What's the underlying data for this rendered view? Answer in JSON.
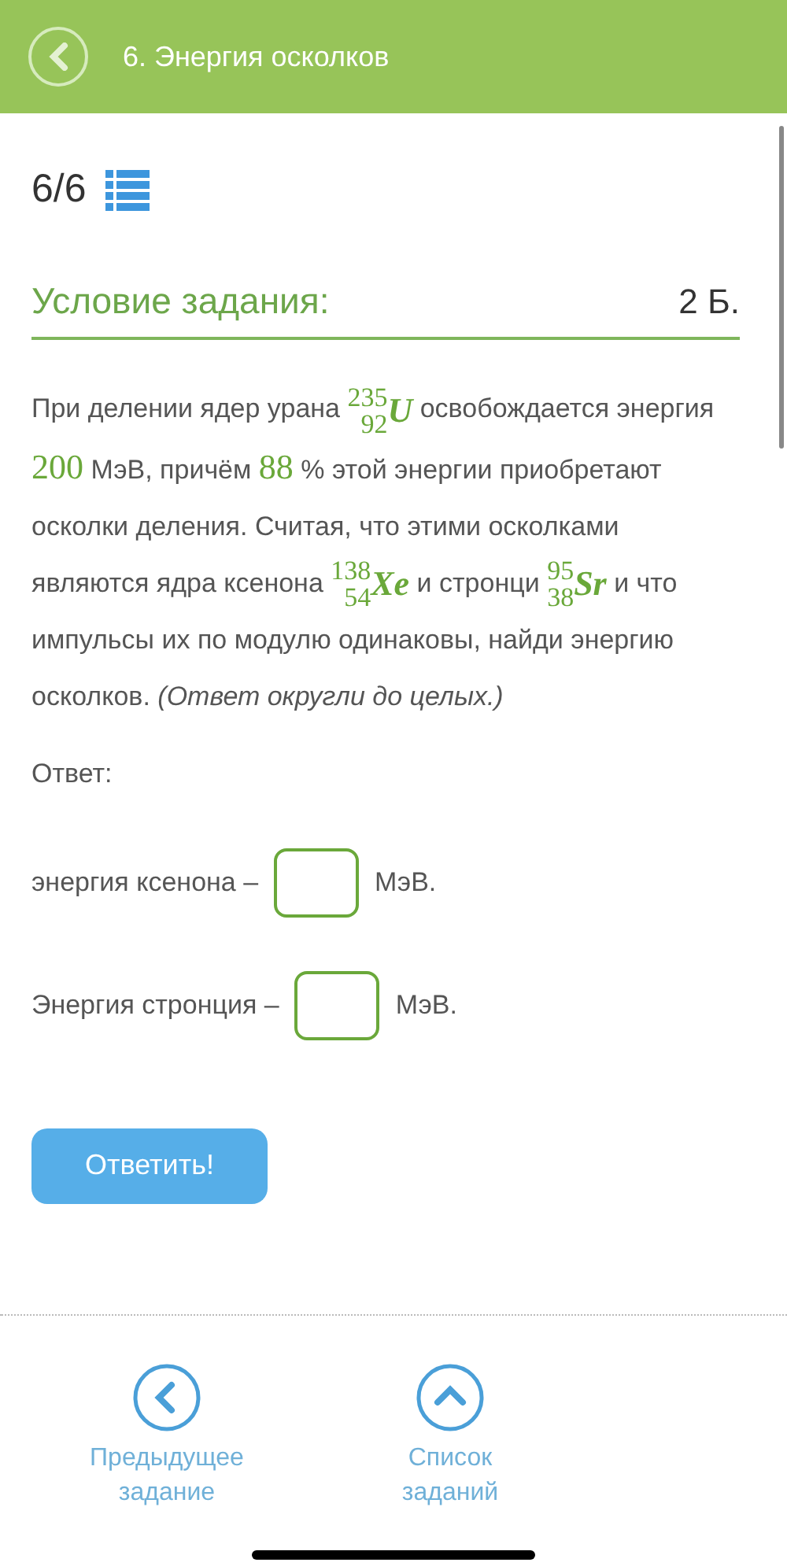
{
  "header": {
    "title": "6. Энергия осколков"
  },
  "progress": {
    "counter": "6/6"
  },
  "task": {
    "heading": "Условие задания:",
    "points": "2 Б.",
    "segments": [
      {
        "kind": "text",
        "text": "При делении ядер урана "
      },
      {
        "kind": "nuclide",
        "mass": "235",
        "charge": "92",
        "symbol": "U"
      },
      {
        "kind": "text",
        "text": " освобождается энергия "
      },
      {
        "kind": "number",
        "text": "200"
      },
      {
        "kind": "text",
        "text": " МэВ, причём "
      },
      {
        "kind": "number",
        "text": "88"
      },
      {
        "kind": "text",
        "text": " % этой энергии приобретают осколки деления. Считая, что этими осколками являются ядра ксенона "
      },
      {
        "kind": "nuclide",
        "mass": "138",
        "charge": "54",
        "symbol": "Xe"
      },
      {
        "kind": "text",
        "text": " и стронци "
      },
      {
        "kind": "nuclide",
        "mass": "95",
        "charge": "38",
        "symbol": "Sr"
      },
      {
        "kind": "text",
        "text": " и что импульсы их по модулю одинаковы, найди энергию осколков. "
      },
      {
        "kind": "italic",
        "text": "(Ответ округли до целых.)"
      }
    ]
  },
  "answer": {
    "label": "Ответ:",
    "rows": [
      {
        "before": "энергия ксенона –",
        "after": "МэВ."
      },
      {
        "before": "Энергия стронция –",
        "after": "МэВ."
      }
    ],
    "submit": "Ответить!"
  },
  "footer": [
    {
      "kind": "prev",
      "label": "Предыдущее задание"
    },
    {
      "kind": "list",
      "label": "Список заданий"
    }
  ]
}
